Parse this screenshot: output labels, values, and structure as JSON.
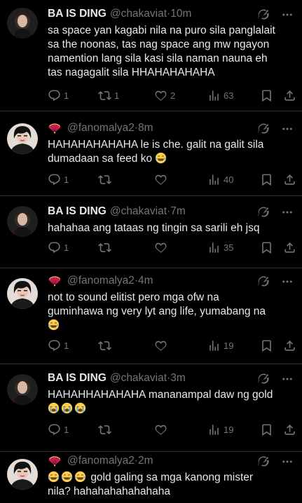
{
  "tweets": [
    {
      "name": "BA IS DING",
      "handle": "@chakaviat",
      "time": "·10m",
      "body": "sa space yan kagabi nila na puro sila panglalait\nsa the noonas, tas nag space ang mw ngayon\nnamention lang sila kasi sila naman nauna eh\ntas nagagalit sila HHAHAHAHAHA",
      "replies": "1",
      "retweets": "1",
      "likes": "2",
      "views": "63"
    },
    {
      "name": "",
      "handle": "@fanomalya2",
      "time": "·8m",
      "body": "HAHAHAHAHAHA le is che. galit na galit sila\ndumadaan sa feed ko",
      "replies": "1",
      "retweets": "",
      "likes": "",
      "views": "40"
    },
    {
      "name": "BA IS DING",
      "handle": "@chakaviat",
      "time": "·7m",
      "body": "hahahaa ang tataas ng tingin sa sarili eh jsq",
      "replies": "1",
      "retweets": "",
      "likes": "",
      "views": "35"
    },
    {
      "name": "",
      "handle": "@fanomalya2",
      "time": "·4m",
      "body": "not to sound elitist pero mga ofw na\nguminhawa ng very lyt ang life, yumabang na",
      "replies": "1",
      "retweets": "",
      "likes": "",
      "views": "19"
    },
    {
      "name": "BA IS DING",
      "handle": "@chakaviat",
      "time": "·3m",
      "body": "HAHAHHAHAHAHA mananampal daw ng gold",
      "replies": "1",
      "retweets": "",
      "likes": "",
      "views": "19"
    },
    {
      "name": "",
      "handle": "@fanomalya2",
      "time": "·2m",
      "body": "gold galing sa mga kanong mister\nnila? hahahahahahahaha",
      "replies": "",
      "retweets": "",
      "likes": "",
      "views": ""
    }
  ],
  "colors": {
    "background": "#000000",
    "text": "#e7e9ea",
    "muted": "#71767b",
    "divider": "#2f3336",
    "fan": "#f4212e"
  },
  "icons": {
    "reply": "comment-bubble-icon",
    "retweet": "retweet-icon",
    "like": "heart-icon",
    "views": "bar-chart-icon",
    "bookmark": "bookmark-icon",
    "share": "share-icon",
    "grok": "grok-icon",
    "more": "more-dots-icon",
    "fan": "folding-fan-icon",
    "emoji_laugh": "tears-of-joy-emoji",
    "emoji_sob": "loudly-crying-emoji"
  }
}
